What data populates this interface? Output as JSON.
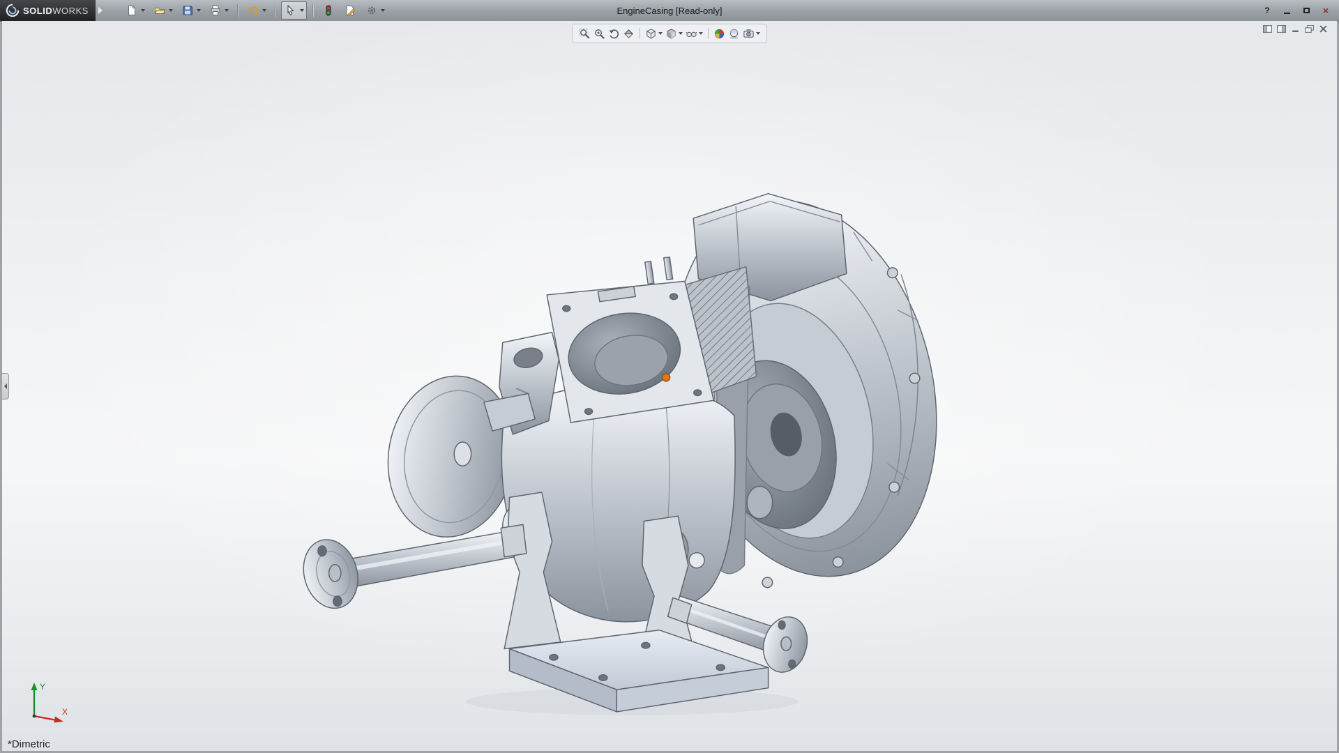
{
  "app": {
    "brand": {
      "bold": "SOLID",
      "light": "WORKS"
    }
  },
  "titlebar": {
    "title": "EngineCasing [Read-only]",
    "help_glyph": "?",
    "close_glyph": "×"
  },
  "toolbars": {
    "main": [
      {
        "icon": "new-document",
        "dropdown": true
      },
      {
        "icon": "open",
        "dropdown": true
      },
      {
        "icon": "save",
        "dropdown": true
      },
      {
        "icon": "print",
        "dropdown": true
      },
      {
        "icon": "undo",
        "dropdown": true
      },
      {
        "icon": "select",
        "dropdown": true,
        "active": true
      },
      {
        "icon": "rebuild",
        "dropdown": false
      },
      {
        "icon": "file-properties",
        "dropdown": false
      },
      {
        "icon": "options",
        "dropdown": true
      }
    ],
    "heads_up": [
      {
        "icon": "zoom-to-fit",
        "dropdown": false
      },
      {
        "icon": "zoom-to-area",
        "dropdown": false
      },
      {
        "icon": "previous-view",
        "dropdown": false
      },
      {
        "icon": "section-view",
        "dropdown": false
      },
      {
        "icon": "view-orientation",
        "dropdown": true
      },
      {
        "icon": "display-style",
        "dropdown": true
      },
      {
        "icon": "hide-show-items",
        "dropdown": true
      },
      {
        "icon": "edit-appearance",
        "dropdown": false
      },
      {
        "icon": "apply-scene",
        "dropdown": false
      },
      {
        "icon": "view-settings",
        "dropdown": true
      }
    ],
    "document_controls": [
      "previous-document",
      "next-document",
      "minimize-document",
      "restore-document",
      "close-document"
    ]
  },
  "viewport": {
    "orientation_label": "*Dimetric",
    "triad": {
      "x": "X",
      "y": "Y"
    }
  },
  "colors": {
    "axis_x": "#cc2a20",
    "axis_y": "#1f8f24",
    "highlight_marker": "#e0761f",
    "rebuild_red": "#cf3a2e",
    "rebuild_green": "#3da23d"
  }
}
